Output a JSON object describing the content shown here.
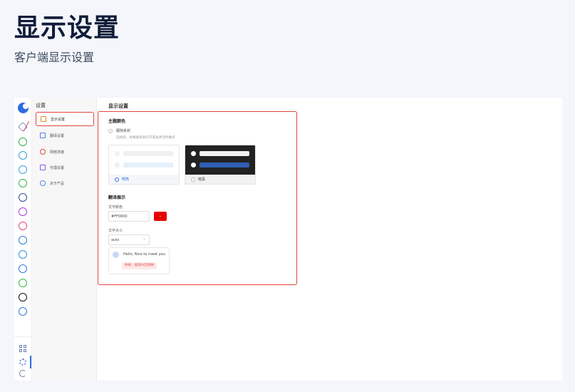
{
  "hero": {
    "title": "显示设置",
    "subtitle": "客户端显示设置"
  },
  "nav": {
    "title": "设置",
    "items": [
      {
        "label": "显示设置",
        "icon": "monitor-icon"
      },
      {
        "label": "翻译设置",
        "icon": "translate-icon"
      },
      {
        "label": "网络测速",
        "icon": "speedometer-icon"
      },
      {
        "label": "代理设置",
        "icon": "proxy-icon"
      },
      {
        "label": "关于产品",
        "icon": "user-icon"
      }
    ]
  },
  "rail": {
    "icons": [
      "home-icon",
      "whatsapp-icon",
      "telegram-icon",
      "telegram-icon",
      "line-icon",
      "facebook-icon",
      "messenger-icon",
      "instagram-icon",
      "zalo-icon",
      "twitter-icon",
      "messenger-icon",
      "wechat-icon",
      "tiktok-icon",
      "add-icon"
    ],
    "bottom": [
      "apps-grid-icon",
      "settings-gear-icon",
      "logout-icon"
    ]
  },
  "content": {
    "title": "显示设置",
    "theme": {
      "section": "主题颜色",
      "follow_system": "跟随系统",
      "follow_hint": "选择后，将根据系统打开或关闭深色模式",
      "light": "明亮",
      "dark": "暗黑"
    },
    "translation": {
      "section": "翻译展示",
      "color_label": "文字颜色",
      "color_value": "#FF0000",
      "size_label": "文字大小",
      "size_value": "auto",
      "preview_message": "Hello, Nice to meet you",
      "preview_translation": "你好，很高兴见到你"
    }
  },
  "colors": {
    "accent": "#2f6de1",
    "highlight": "#e5443d",
    "swatch": "#e80000"
  }
}
